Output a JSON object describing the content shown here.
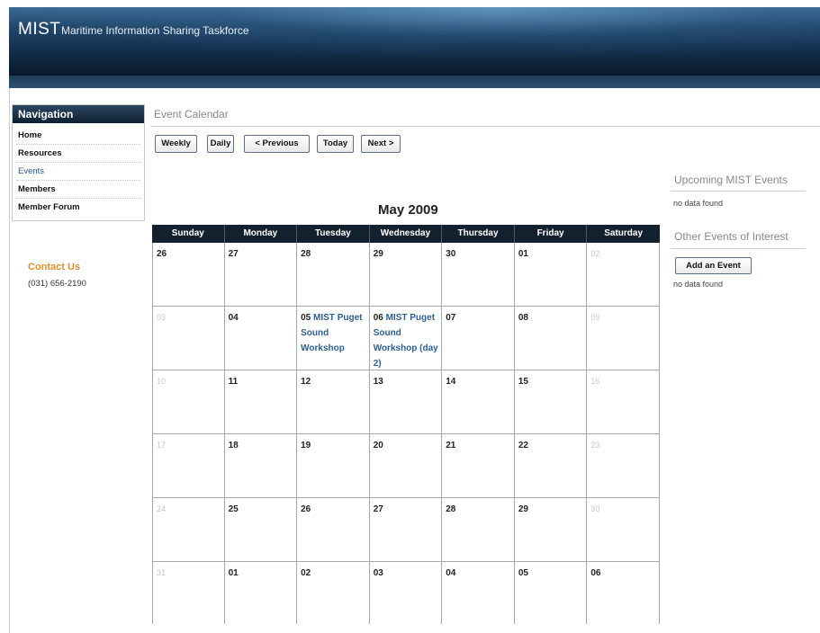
{
  "header": {
    "logo": "MIST",
    "tagline": "Maritime Information Sharing Taskforce"
  },
  "nav": {
    "title": "Navigation",
    "items": [
      {
        "label": "Home",
        "active": false
      },
      {
        "label": "Resources",
        "active": false
      },
      {
        "label": "Events",
        "active": true
      },
      {
        "label": "Members",
        "active": false
      },
      {
        "label": "Member Forum",
        "active": false
      }
    ]
  },
  "contact": {
    "title": "Contact Us",
    "phone": "(031) 656-2190"
  },
  "main": {
    "section_title": "Event Calendar",
    "buttons": {
      "weekly": "Weekly",
      "daily": "Daily",
      "previous": "< Previous",
      "today": "Today",
      "next": "Next >"
    },
    "month_title": "May 2009"
  },
  "calendar": {
    "weekdays": [
      "Sunday",
      "Monday",
      "Tuesday",
      "Wednesday",
      "Thursday",
      "Friday",
      "Saturday"
    ],
    "weeks": [
      [
        {
          "day": "26",
          "muted": false
        },
        {
          "day": "27",
          "muted": false
        },
        {
          "day": "28",
          "muted": false
        },
        {
          "day": "29",
          "muted": false
        },
        {
          "day": "30",
          "muted": false
        },
        {
          "day": "01",
          "muted": false
        },
        {
          "day": "02",
          "muted": true
        }
      ],
      [
        {
          "day": "03",
          "muted": true
        },
        {
          "day": "04",
          "muted": false
        },
        {
          "day": "05",
          "muted": false,
          "event": "MIST Puget Sound Workshop"
        },
        {
          "day": "06",
          "muted": false,
          "event": "MIST Puget Sound Workshop (day 2)"
        },
        {
          "day": "07",
          "muted": false
        },
        {
          "day": "08",
          "muted": false
        },
        {
          "day": "09",
          "muted": true
        }
      ],
      [
        {
          "day": "10",
          "muted": true
        },
        {
          "day": "11",
          "muted": false
        },
        {
          "day": "12",
          "muted": false
        },
        {
          "day": "13",
          "muted": false
        },
        {
          "day": "14",
          "muted": false
        },
        {
          "day": "15",
          "muted": false
        },
        {
          "day": "16",
          "muted": true
        }
      ],
      [
        {
          "day": "17",
          "muted": true
        },
        {
          "day": "18",
          "muted": false
        },
        {
          "day": "19",
          "muted": false
        },
        {
          "day": "20",
          "muted": false
        },
        {
          "day": "21",
          "muted": false
        },
        {
          "day": "22",
          "muted": false
        },
        {
          "day": "23",
          "muted": true
        }
      ],
      [
        {
          "day": "24",
          "muted": true
        },
        {
          "day": "25",
          "muted": false
        },
        {
          "day": "26",
          "muted": false
        },
        {
          "day": "27",
          "muted": false
        },
        {
          "day": "28",
          "muted": false
        },
        {
          "day": "29",
          "muted": false
        },
        {
          "day": "30",
          "muted": true
        }
      ],
      [
        {
          "day": "31",
          "muted": true
        },
        {
          "day": "01",
          "muted": false
        },
        {
          "day": "02",
          "muted": false
        },
        {
          "day": "03",
          "muted": false
        },
        {
          "day": "04",
          "muted": false
        },
        {
          "day": "05",
          "muted": false
        },
        {
          "day": "06",
          "muted": false
        }
      ]
    ]
  },
  "sidebar": {
    "upcoming_title": "Upcoming MIST Events",
    "upcoming_empty": "no data found",
    "other_title": "Other Events of Interest",
    "add_event": "Add an Event",
    "other_empty": "no data found"
  }
}
